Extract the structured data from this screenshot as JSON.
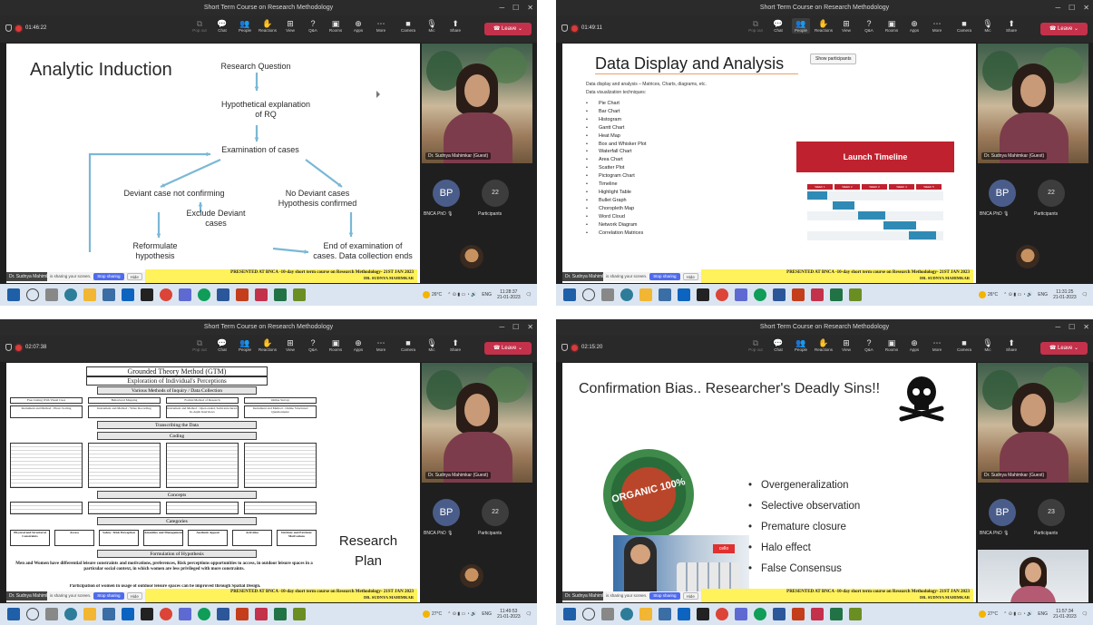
{
  "window_title": "Short Term Course on Research Methodology",
  "toolbar": {
    "items": [
      {
        "label": "Pop out",
        "glyph": "⧉",
        "dim": true
      },
      {
        "label": "Chat",
        "glyph": "💬"
      },
      {
        "label": "People",
        "glyph": "👥"
      },
      {
        "label": "Reactions",
        "glyph": "✋"
      },
      {
        "label": "View",
        "glyph": "⊞"
      },
      {
        "label": "Q&A",
        "glyph": "?"
      },
      {
        "label": "Rooms",
        "glyph": "▣"
      },
      {
        "label": "Apps",
        "glyph": "⊕"
      },
      {
        "label": "More",
        "glyph": "⋯"
      }
    ],
    "right_items": [
      {
        "label": "Camera",
        "glyph": "■"
      },
      {
        "label": "Mic",
        "glyph": "🎙"
      },
      {
        "label": "Share",
        "glyph": "⬆"
      }
    ],
    "leave_label": "Leave",
    "tooltip": "Show participants"
  },
  "presenter_label": "Dr. Sudnya Mahimkar (Guest)",
  "presenter_footer": "Dr. Sudnya Mahimkar (Guest)",
  "sharing_text": "is sharing your screen.",
  "stop_sharing": "Stop sharing",
  "hide_label": "Hide",
  "participant_initials": "BP",
  "participant_name": "BNCA PhD",
  "participants_label": "Participants",
  "banner_line1": "PRESENTED AT BNCA -10-day short term course on Research Methodology- 21ST JAN 2023",
  "banner_line2": "DR. SUDNYA MAHIMKAR",
  "shots": [
    {
      "timer": "01:46:22",
      "participants_count": "22",
      "temp": "26°C",
      "clock": "11:28:37",
      "date": "21-01-2023",
      "lang": "ENG"
    },
    {
      "timer": "01:49:11",
      "participants_count": "22",
      "temp": "26°C",
      "clock": "11:31:25",
      "date": "21-01-2023",
      "lang": "ENG"
    },
    {
      "timer": "02:07:38",
      "participants_count": "22",
      "temp": "27°C",
      "clock": "11:49:53",
      "date": "21-01-2023",
      "lang": "ENG"
    },
    {
      "timer": "02:15:20",
      "participants_count": "23",
      "temp": "27°C",
      "clock": "11:57:34",
      "date": "21-01-2023",
      "lang": "ENG"
    }
  ],
  "slide1": {
    "title": "Analytic Induction",
    "research_question": "Research Question",
    "hypothetical": "Hypothetical explanation of RQ",
    "examination": "Examination of cases",
    "deviant": "Deviant case not confirming",
    "no_deviant": "No Deviant cases Hypothesis confirmed",
    "exclude": "Exclude Deviant cases",
    "reformulate": "Reformulate hypothesis",
    "end": "End of examination of cases. Data collection ends"
  },
  "slide2": {
    "title": "Data Display and Analysis",
    "sub1": "Data display and analysis – Matrices, Charts, diagrams, etc.",
    "sub2": "Data visualization techniques:",
    "items": [
      "Pie Chart",
      "Bar Chart",
      "Histogram",
      "Gantt Chart",
      "Heat Map",
      "Box and Whisker Plot",
      "Waterfall Chart",
      "Area Chart",
      "Scatter Plot",
      "Pictogram Chart",
      "Timeline",
      "Highlight Table",
      "Bullet Graph",
      "Choropleth Map",
      "Word Cloud",
      "Network Diagram",
      "Correlation Matrices"
    ],
    "launch_title": "Launch Timeline",
    "weeks": [
      "WEEK 1",
      "WEEK 2",
      "WEEK 3",
      "WEEK 4",
      "WEEK 5"
    ]
  },
  "slide3": {
    "title": "Grounded Theory Method (GTM)",
    "subtitle": "Exploration of Individual's Perceptions",
    "methods_head": "Various Methods of Inquiry / Data Collection",
    "methods": [
      "Free Listing With Visual Cues",
      "Behavioral Mapping",
      "Formal Method of Research",
      "Online Survey"
    ],
    "methods2": [
      "Instrument and Method - Photo Sorting",
      "Instrument and Method - Video Recording",
      "Instrument and Method - Open ended, Semi-structured, In-depth Interviews",
      "Instrument and Method - Online Structured Questionnaire"
    ],
    "transcribe": "Transcribing the Data",
    "coding": "Coding",
    "concepts": "Concepts",
    "categories": "Categories",
    "cat_items": [
      "Physical and Structural Constraints",
      "Access",
      "Safety / Risk Perception",
      "Amenities and Management",
      "Aesthetic Appeal",
      "Activities",
      "Intrinsic and Extrinsic Motivations"
    ],
    "formulation": "Formulation of Hypothesis",
    "hypothesis": "Men and Women have differential leisure constraints and motivations, preferences, Risk perceptions opportunities to access, in outdoor leisure spaces in a particular social context, in which women are less privileged with more constraints.",
    "hypothesis2": "Participation of women in usage of outdoor leisure spaces can be improved through Spatial Design.",
    "research_plan": "Research Plan"
  },
  "slide4": {
    "title": "Confirmation Bias.. Researcher's Deadly Sins!!",
    "items": [
      "Overgeneralization",
      "Selective observation",
      "Premature closure",
      "Halo effect",
      "False Consensus"
    ],
    "seal_text": "ORGANIC 100%",
    "promo_logo": "cello"
  },
  "colors": {
    "leave": "#c4314b",
    "accent_red": "#c0212f",
    "banner": "#fff25a",
    "arrow": "#7ab8d6"
  }
}
